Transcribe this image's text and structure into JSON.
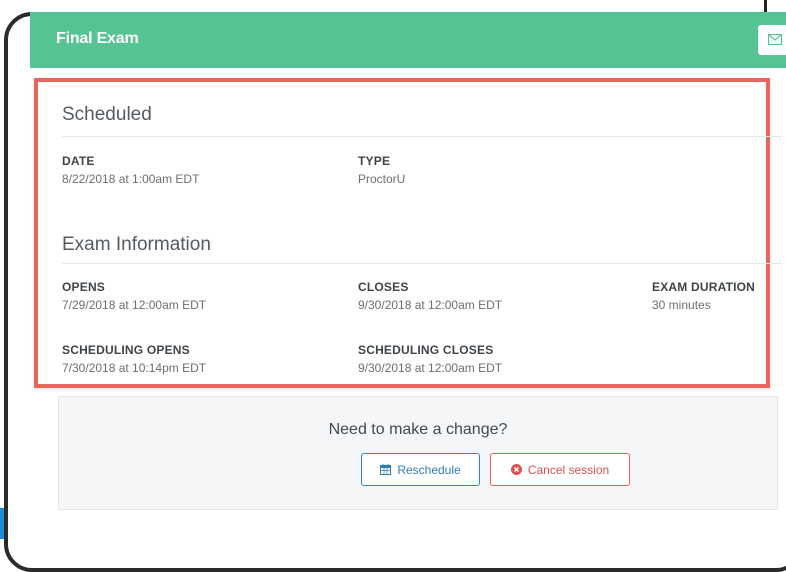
{
  "header": {
    "title": "Final Exam"
  },
  "scheduled": {
    "heading": "Scheduled",
    "date_label": "DATE",
    "date_value": "8/22/2018 at 1:00am EDT",
    "type_label": "TYPE",
    "type_value": "ProctorU"
  },
  "exam_info": {
    "heading": "Exam Information",
    "opens_label": "OPENS",
    "opens_value": "7/29/2018 at 12:00am EDT",
    "closes_label": "CLOSES",
    "closes_value": "9/30/2018 at 12:00am EDT",
    "duration_label": "EXAM DURATION",
    "duration_value": "30 minutes",
    "sched_opens_label": "SCHEDULING OPENS",
    "sched_opens_value": "7/30/2018 at 10:14pm EDT",
    "sched_closes_label": "SCHEDULING CLOSES",
    "sched_closes_value": "9/30/2018 at 12:00am EDT"
  },
  "change_panel": {
    "title": "Need to make a change?",
    "reschedule_label": "Reschedule",
    "cancel_label": "Cancel session"
  },
  "colors": {
    "header_green": "#55c392",
    "highlight_red": "#e8675c",
    "reschedule_blue": "#2f86c8",
    "cancel_red": "#d9534f"
  },
  "icons": {
    "header_button": "envelope-icon",
    "reschedule": "calendar-icon",
    "cancel": "times-circle-icon"
  }
}
